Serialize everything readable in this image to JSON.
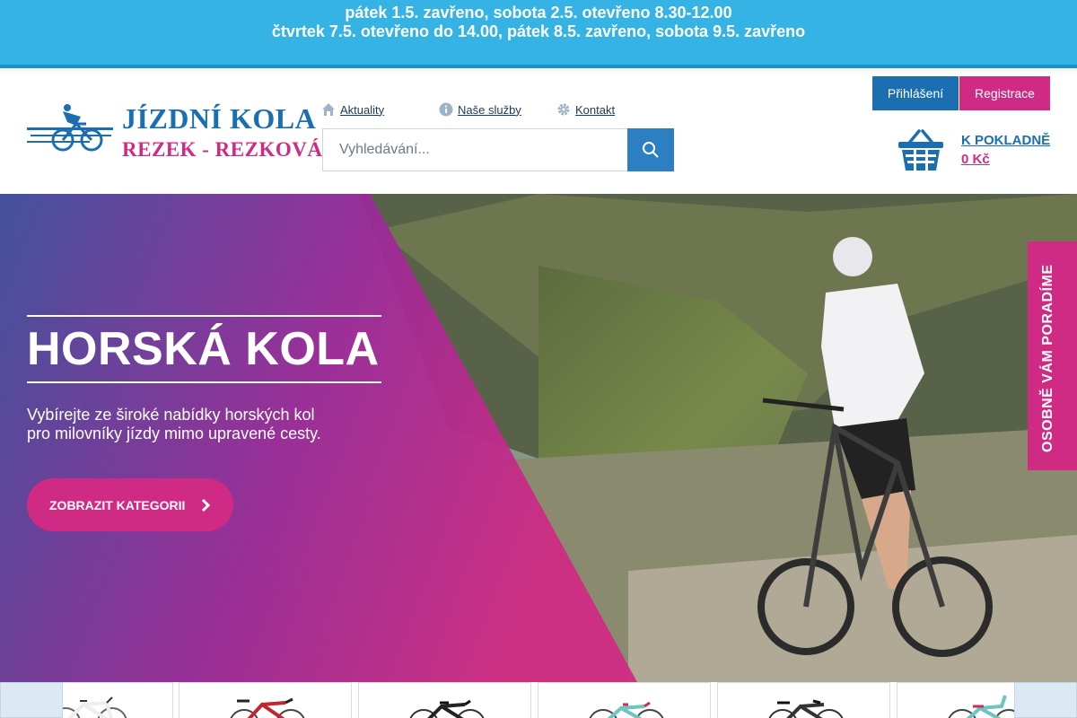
{
  "notice": {
    "line1": "pátek 1.5. zavřeno, sobota 2.5. otevřeno 8.30-12.00",
    "line2": "čtvrtek 7.5. otevřeno do 14.00, pátek 8.5. zavřeno, sobota 9.5. zavřeno"
  },
  "logo": {
    "line1": "JÍZDNÍ KOLA",
    "line2": "REZEK - REZKOVÁ"
  },
  "nav": {
    "aktuality": "Aktuality",
    "sluzby": "Naše služby",
    "kontakt": "Kontakt"
  },
  "search": {
    "placeholder": "Vyhledávání..."
  },
  "account": {
    "login": "Přihlášení",
    "register": "Registrace"
  },
  "cart": {
    "title": "K POKLADNĚ",
    "price": "0 Kč"
  },
  "hero": {
    "title": "HORSKÁ KOLA",
    "subtitle_line1": "Vybírejte ze široké nabídky horských kol",
    "subtitle_line2": "pro milovníky jízdy mimo upravené cesty.",
    "button": "ZOBRAZIT KATEGORII"
  },
  "side_tab": {
    "label": "OSOBNĚ VÁM PORADÍME"
  },
  "product_strip": {
    "cards": [
      "bike-white",
      "bike-red",
      "bike-black",
      "bike-teal",
      "bike-dark",
      "bike-teal-kids"
    ]
  },
  "colors": {
    "notice_bg": "#34b3e4",
    "brand_blue": "#1b6fb0",
    "brand_pink": "#d02b84"
  }
}
